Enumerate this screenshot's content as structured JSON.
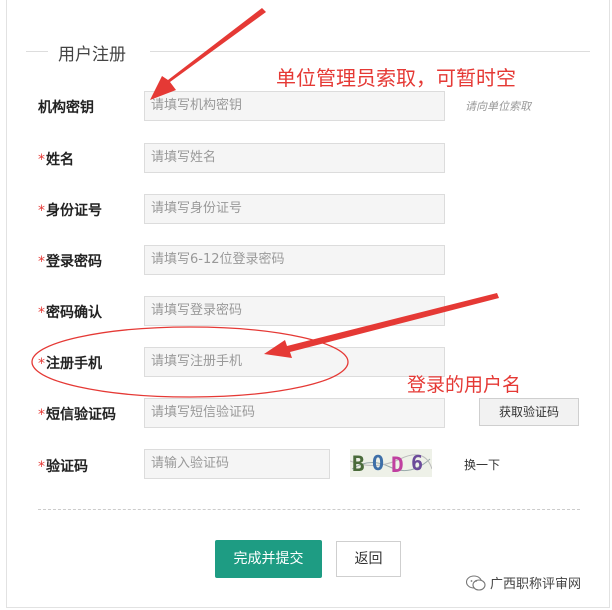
{
  "form": {
    "title": "用户注册",
    "fields": [
      {
        "label": "机构密钥",
        "required": false,
        "placeholder": "请填写机构密钥"
      },
      {
        "label": "姓名",
        "required": true,
        "placeholder": "请填写姓名"
      },
      {
        "label": "身份证号",
        "required": true,
        "placeholder": "请填写身份证号"
      },
      {
        "label": "登录密码",
        "required": true,
        "placeholder": "请填写6-12位登录密码"
      },
      {
        "label": "密码确认",
        "required": true,
        "placeholder": "请填写登录密码"
      },
      {
        "label": "注册手机",
        "required": true,
        "placeholder": "请填写注册手机"
      },
      {
        "label": "短信验证码",
        "required": true,
        "placeholder": "请填写短信验证码"
      },
      {
        "label": "验证码",
        "required": true,
        "placeholder": "请输入验证码"
      }
    ],
    "required_mark": "*",
    "org_key_hint": "请向单位索取",
    "sms_button": "获取验证码",
    "captcha_text": "BOD6",
    "captcha_refresh": "换一下",
    "submit": "完成并提交",
    "back": "返回"
  },
  "annotations": {
    "note1": "单位管理员索取，可暂时空",
    "note2": "登录的用户名",
    "color": "#e53935"
  },
  "watermark": {
    "text": "广西职称评审网",
    "icon": "wechat-icon"
  }
}
